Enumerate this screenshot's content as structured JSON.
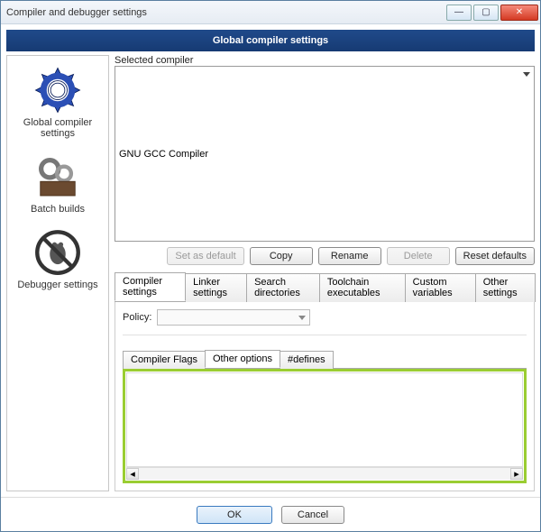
{
  "window": {
    "title": "Compiler and debugger settings"
  },
  "header": {
    "title": "Global compiler settings"
  },
  "sidebar": {
    "items": [
      {
        "label": "Global compiler settings"
      },
      {
        "label": "Batch builds"
      },
      {
        "label": "Debugger settings"
      }
    ]
  },
  "main": {
    "selected_compiler_label": "Selected compiler",
    "selected_compiler_value": "GNU GCC Compiler",
    "buttons": {
      "set_default": "Set as default",
      "copy": "Copy",
      "rename": "Rename",
      "delete": "Delete",
      "reset": "Reset defaults"
    },
    "tabs": [
      "Compiler settings",
      "Linker settings",
      "Search directories",
      "Toolchain executables",
      "Custom variables",
      "Other settings"
    ],
    "policy_label": "Policy:",
    "policy_value": "",
    "subtabs": [
      "Compiler Flags",
      "Other options",
      "#defines"
    ],
    "other_options_text": ""
  },
  "footer": {
    "ok": "OK",
    "cancel": "Cancel"
  }
}
